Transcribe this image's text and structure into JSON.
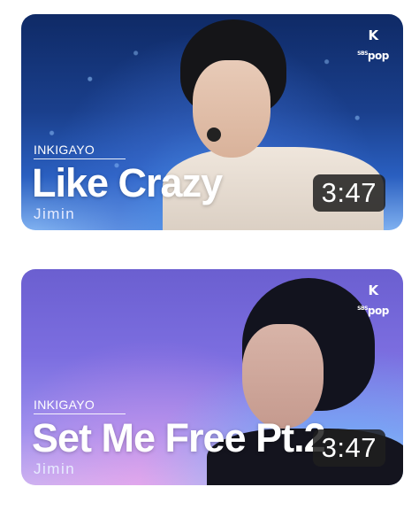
{
  "videos": [
    {
      "channel_logo": "SBS K pop",
      "show": "INKIGAYO",
      "title": "Like Crazy",
      "artist": "Jimin",
      "duration": "3:47"
    },
    {
      "channel_logo": "SBS K pop",
      "show": "INKIGAYO",
      "title": "Set Me Free Pt.2",
      "artist": "Jimin",
      "duration": "3:47"
    }
  ],
  "colors": {
    "card1_bg": "#1a3f8c",
    "card2_bg": "#7c6ee0",
    "badge_bg": "#1e1e1e",
    "text": "#ffffff"
  }
}
